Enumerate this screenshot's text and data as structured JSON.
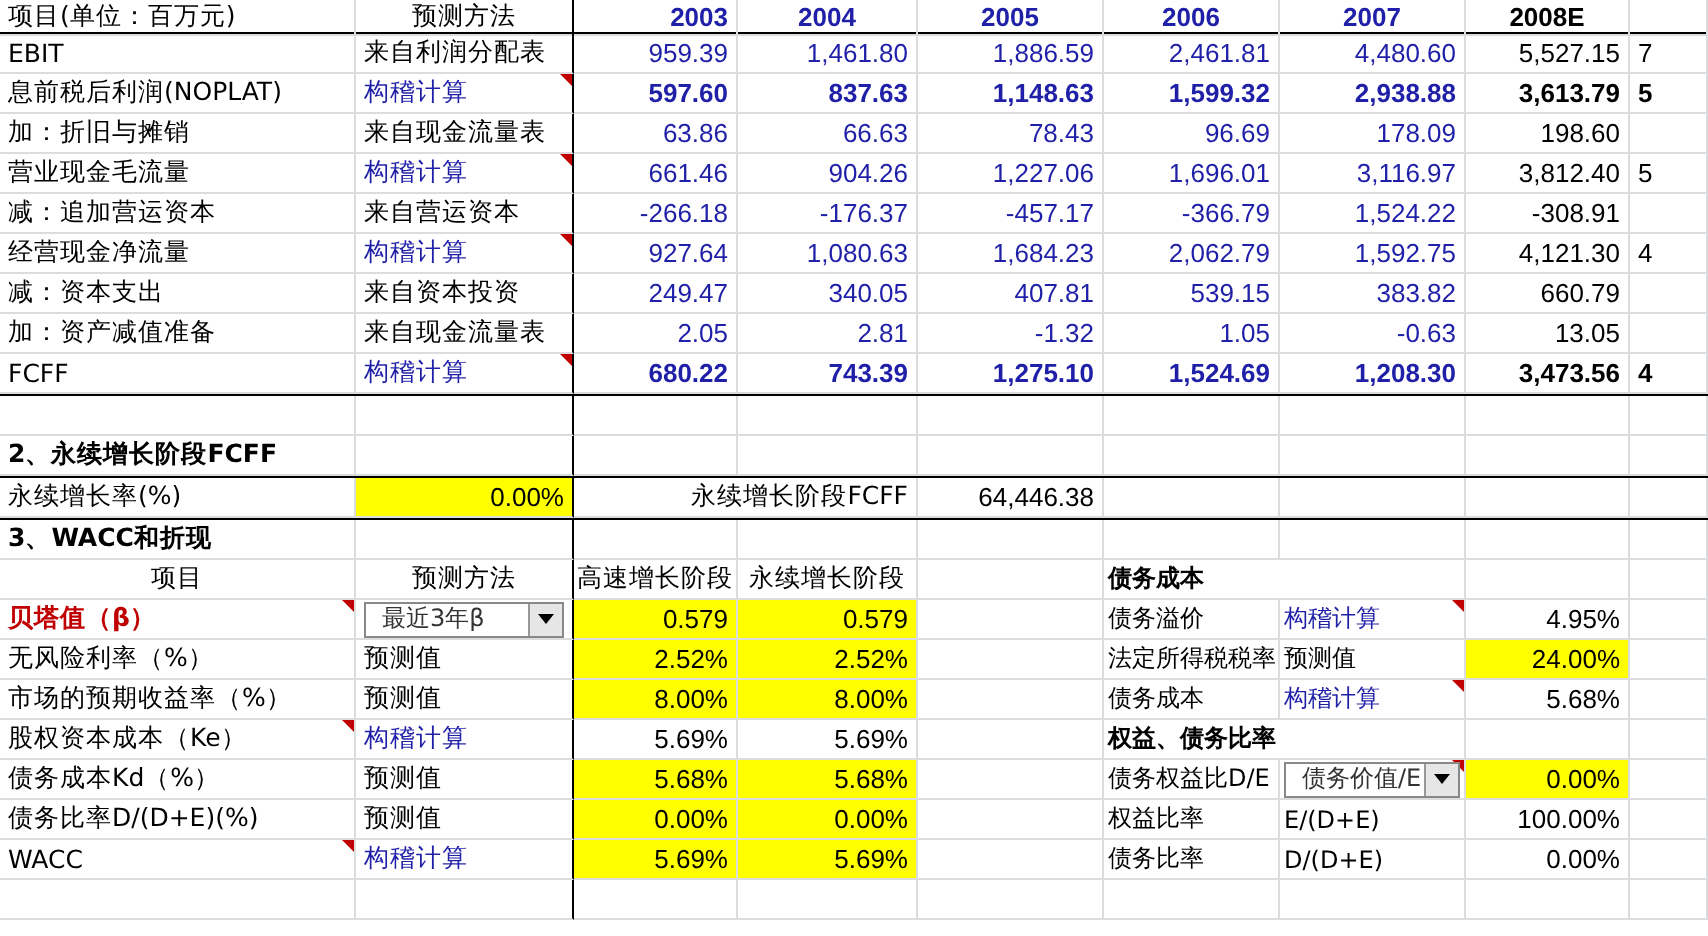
{
  "fcff_table": {
    "header": {
      "label": "项目(单位：百万元)",
      "method": "预测方法",
      "years": [
        "2003",
        "2004",
        "2005",
        "2006",
        "2007",
        "2008E"
      ]
    },
    "rows": [
      {
        "label": "EBIT",
        "method": "来自利润分配表",
        "kind": "source",
        "bold": false,
        "values": [
          "959.39",
          "1,461.80",
          "1,886.59",
          "2,461.81",
          "4,480.60",
          "5,527.15"
        ],
        "column_8": "7"
      },
      {
        "label": "息前税后利润(NOPLAT)",
        "method": "构稽计算",
        "kind": "calc",
        "bold": true,
        "note": true,
        "values": [
          "597.60",
          "837.63",
          "1,148.63",
          "1,599.32",
          "2,938.88",
          "3,613.79"
        ],
        "column_8": "5"
      },
      {
        "label": "加：折旧与摊销",
        "method": "来自现金流量表",
        "kind": "source",
        "bold": false,
        "values": [
          "63.86",
          "66.63",
          "78.43",
          "96.69",
          "178.09",
          "198.60"
        ]
      },
      {
        "label": "营业现金毛流量",
        "method": "构稽计算",
        "kind": "calc",
        "bold": false,
        "note": true,
        "values": [
          "661.46",
          "904.26",
          "1,227.06",
          "1,696.01",
          "3,116.97",
          "3,812.40"
        ],
        "column_8": "5"
      },
      {
        "label": "减：追加营运资本",
        "method": "来自营运资本",
        "kind": "source",
        "bold": false,
        "values": [
          "-266.18",
          "-176.37",
          "-457.17",
          "-366.79",
          "1,524.22",
          "-308.91"
        ]
      },
      {
        "label": "经营现金净流量",
        "method": "构稽计算",
        "kind": "calc",
        "bold": false,
        "note": true,
        "values": [
          "927.64",
          "1,080.63",
          "1,684.23",
          "2,062.79",
          "1,592.75",
          "4,121.30"
        ],
        "column_8": "4"
      },
      {
        "label": "减：资本支出",
        "method": "来自资本投资",
        "kind": "source",
        "bold": false,
        "values": [
          "249.47",
          "340.05",
          "407.81",
          "539.15",
          "383.82",
          "660.79"
        ]
      },
      {
        "label": "加：资产减值准备",
        "method": "来自现金流量表",
        "kind": "source",
        "bold": false,
        "values": [
          "2.05",
          "2.81",
          "-1.32",
          "1.05",
          "-0.63",
          "13.05"
        ]
      },
      {
        "label": "FCFF",
        "method": "构稽计算",
        "kind": "calc",
        "bold": true,
        "note": true,
        "values": [
          "680.22",
          "743.39",
          "1,275.10",
          "1,524.69",
          "1,208.30",
          "3,473.56"
        ],
        "column_8": "4"
      }
    ]
  },
  "perpetual": {
    "title": "2、永续增长阶段FCFF",
    "growth_label": "永续增长率(%)",
    "growth_value": "0.00%",
    "fcff_label": "永续增长阶段FCFF",
    "fcff_value": "64,446.38"
  },
  "wacc": {
    "title": "3、WACC和折现",
    "header": [
      "项目",
      "预测方法",
      "高速增长阶段",
      "永续增长阶段"
    ],
    "rows": [
      {
        "label": "贝塔值（β）",
        "emphasis": true,
        "note": true,
        "method": "最近3年β",
        "kind": "dropdown",
        "highlight": true,
        "values": [
          "0.579",
          "0.579"
        ]
      },
      {
        "label": "无风险利率（%）",
        "emphasis": false,
        "method": "预测值",
        "kind": "source",
        "highlight": true,
        "values": [
          "2.52%",
          "2.52%"
        ]
      },
      {
        "label": "市场的预期收益率（%）",
        "emphasis": false,
        "method": "预测值",
        "kind": "source",
        "highlight": true,
        "values": [
          "8.00%",
          "8.00%"
        ]
      },
      {
        "label": "股权资本成本（Ke）",
        "emphasis": false,
        "note": true,
        "method": "构稽计算",
        "kind": "calc",
        "highlight": false,
        "values": [
          "5.69%",
          "5.69%"
        ]
      },
      {
        "label": "债务成本Kd（%）",
        "emphasis": false,
        "method": "预测值",
        "kind": "source",
        "highlight": true,
        "values": [
          "5.68%",
          "5.68%"
        ]
      },
      {
        "label": "债务比率D/(D+E)(%)",
        "emphasis": false,
        "method": "预测值",
        "kind": "source",
        "highlight": true,
        "values": [
          "0.00%",
          "0.00%"
        ]
      },
      {
        "label": "WACC",
        "emphasis": false,
        "note": true,
        "method": "构稽计算",
        "kind": "calc",
        "highlight": true,
        "values": [
          "5.69%",
          "5.69%"
        ]
      }
    ]
  },
  "debt": {
    "rows": [
      {
        "kind": "heading",
        "label": "债务成本"
      },
      {
        "kind": "calc",
        "label": "债务溢价",
        "method": "构稽计算",
        "note": true,
        "value": "4.95%",
        "highlight": false
      },
      {
        "kind": "source",
        "label": "法定所得税税率",
        "method": "预测值",
        "value": "24.00%",
        "highlight": true
      },
      {
        "kind": "calc",
        "label": "债务成本",
        "method": "构稽计算",
        "note": true,
        "value": "5.68%",
        "highlight": false
      },
      {
        "kind": "heading",
        "label": "权益、债务比率"
      },
      {
        "kind": "dropdown",
        "label": "债务权益比D/E",
        "method": "债务价值/E",
        "note": true,
        "value": "0.00%",
        "highlight": true
      },
      {
        "kind": "source",
        "label": "权益比率",
        "method": "E/(D+E)",
        "value": "100.00%",
        "highlight": false
      },
      {
        "kind": "source",
        "label": "债务比率",
        "method": "D/(D+E)",
        "value": "0.00%",
        "highlight": false
      }
    ]
  }
}
